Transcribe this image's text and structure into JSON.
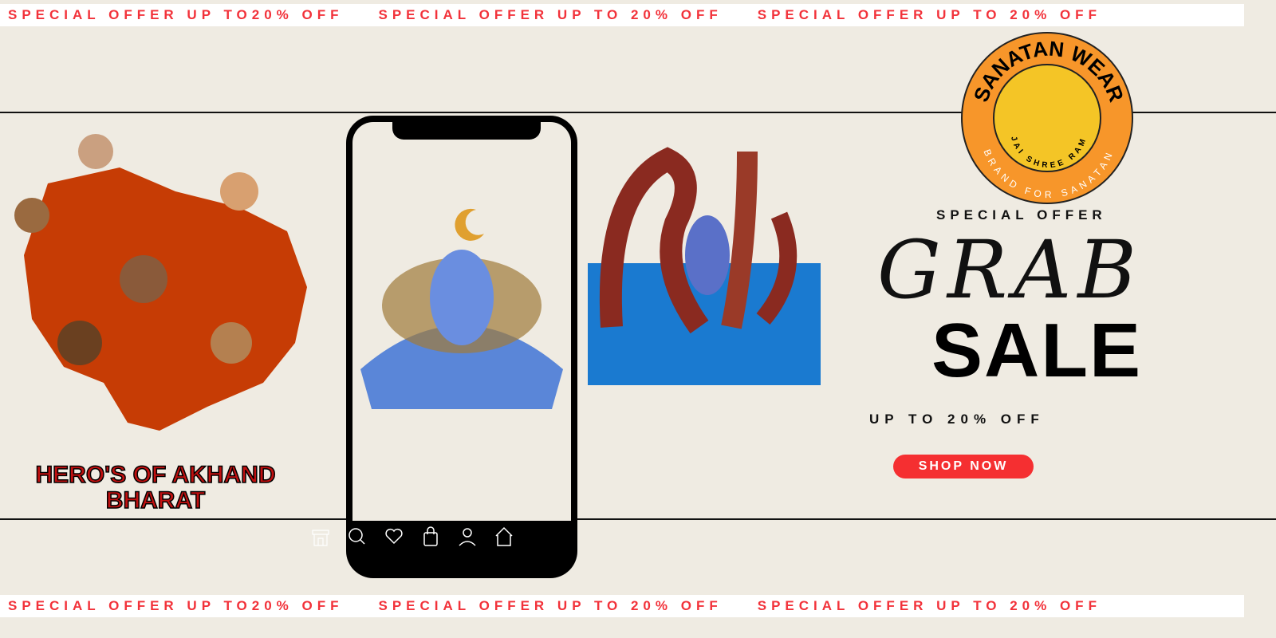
{
  "ticker_top": [
    "SPECIAL OFFER UP TO20% OFF",
    "SPECIAL OFFER UP TO 20% OFF",
    "SPECIAL OFFER UP TO 20% OFF"
  ],
  "ticker_bottom": [
    "SPECIAL OFFER UP TO20% OFF",
    "SPECIAL OFFER UP TO 20% OFF",
    "SPECIAL OFFER UP TO 20% OFF"
  ],
  "logo": {
    "title": "SANATAN WEAR",
    "tagline": "JAI SHREE RAM",
    "subtitle": "BRAND FOR SANATAN"
  },
  "promo": {
    "special_offer": "SPECIAL OFFER",
    "grab": "GRAB",
    "sale": "SALE",
    "up_to": "UP TO 20% OFF",
    "shop_now": "SHOP NOW"
  },
  "left_art": {
    "caption_line1": "HERO'S OF AKHAND",
    "caption_line2": "BHARAT"
  },
  "colors": {
    "accent": "#f52f31",
    "background": "#efebe2",
    "logo_orange": "#f7962a"
  }
}
